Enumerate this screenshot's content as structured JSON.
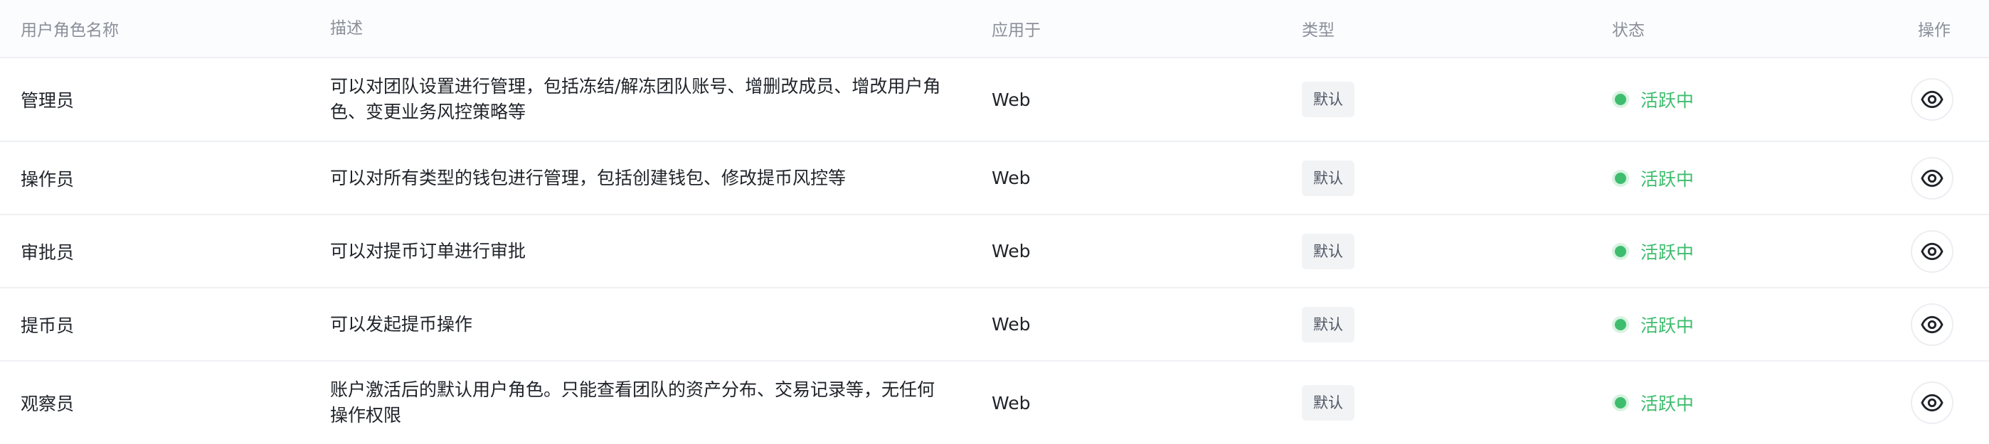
{
  "columns": {
    "name": "用户角色名称",
    "desc": "描述",
    "app": "应用于",
    "type": "类型",
    "status": "状态",
    "action": "操作"
  },
  "rows": [
    {
      "name": "管理员",
      "desc": "可以对团队设置进行管理，包括冻结/解冻团队账号、增删改成员、增改用户角色、变更业务风控策略等",
      "app": "Web",
      "type": "默认",
      "status": "活跃中"
    },
    {
      "name": "操作员",
      "desc": "可以对所有类型的钱包进行管理，包括创建钱包、修改提币风控等",
      "app": "Web",
      "type": "默认",
      "status": "活跃中"
    },
    {
      "name": "审批员",
      "desc": "可以对提币订单进行审批",
      "app": "Web",
      "type": "默认",
      "status": "活跃中"
    },
    {
      "name": "提币员",
      "desc": "可以发起提币操作",
      "app": "Web",
      "type": "默认",
      "status": "活跃中"
    },
    {
      "name": "观察员",
      "desc": "账户激活后的默认用户角色。只能查看团队的资产分布、交易记录等，无任何操作权限",
      "app": "Web",
      "type": "默认",
      "status": "活跃中"
    }
  ],
  "colors": {
    "active": "#3fbd6e",
    "header_bg": "#fbfcfe",
    "tag_bg": "#f2f3f5"
  },
  "icons": {
    "action": "eye-icon",
    "status": "status-dot-icon"
  }
}
